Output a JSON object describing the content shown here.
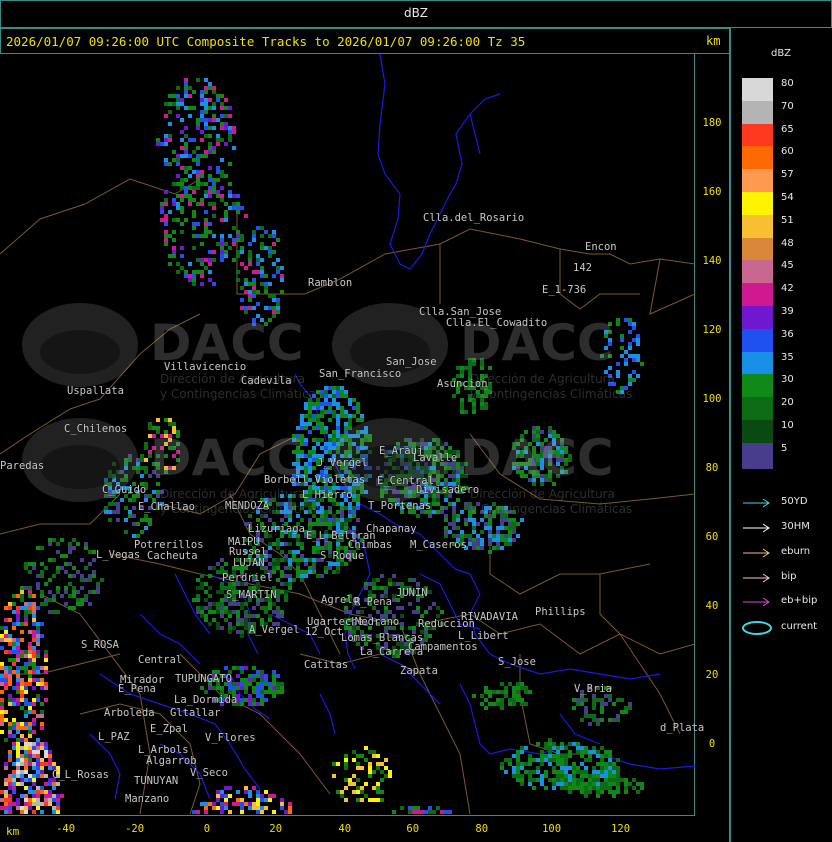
{
  "window": {
    "title": "dBZ"
  },
  "header": {
    "text": "2026/01/07 09:26:00 UTC Composite Tracks to 2026/01/07 09:26:00 Tz 35",
    "unit": "km"
  },
  "axes": {
    "x_unit": "km",
    "x_ticks": [
      "-40",
      "-20",
      "0",
      "20",
      "40",
      "60",
      "80",
      "100",
      "120"
    ],
    "y_ticks": [
      "180",
      "160",
      "140",
      "120",
      "100",
      "80",
      "60",
      "40",
      "20",
      "0"
    ]
  },
  "legend": {
    "title": "dBZ",
    "scale": [
      {
        "label": "80",
        "color": "#d8d8d8"
      },
      {
        "label": "70",
        "color": "#b4b4b4"
      },
      {
        "label": "65",
        "color": "#ff3820"
      },
      {
        "label": "60",
        "color": "#ff6a00"
      },
      {
        "label": "57",
        "color": "#ff9a50"
      },
      {
        "label": "54",
        "color": "#fff400"
      },
      {
        "label": "51",
        "color": "#f8c030"
      },
      {
        "label": "48",
        "color": "#d88838"
      },
      {
        "label": "45",
        "color": "#c86890"
      },
      {
        "label": "42",
        "color": "#d01890"
      },
      {
        "label": "39",
        "color": "#7018d0"
      },
      {
        "label": "36",
        "color": "#2050f0"
      },
      {
        "label": "35",
        "color": "#1890e8"
      },
      {
        "label": "30",
        "color": "#108818"
      },
      {
        "label": "20",
        "color": "#0c6c14"
      },
      {
        "label": "10",
        "color": "#084a10"
      },
      {
        "label": "5",
        "color": "#483c8c"
      }
    ],
    "tracks": [
      {
        "label": "50YD",
        "color": "#40d8e0"
      },
      {
        "label": "30HM",
        "color": "#ffffff"
      },
      {
        "label": "eburn",
        "color": "#f0c080"
      },
      {
        "label": "bip",
        "color": "#f8c8c8"
      },
      {
        "label": "eb+bip",
        "color": "#e040e0"
      },
      {
        "label": "current",
        "color": "#40d8e0"
      }
    ]
  },
  "watermark": {
    "name": "DACC",
    "line1": "Dirección de Agricultura",
    "line2": "y Contingencias Climáticas"
  },
  "places": [
    {
      "name": "Clla.del_Rosario"
    },
    {
      "name": "Encon"
    },
    {
      "name": "142"
    },
    {
      "name": "E_1-736"
    },
    {
      "name": "Ramblon"
    },
    {
      "name": "Clla.San_Jose"
    },
    {
      "name": "Clla.El_Cowadito"
    },
    {
      "name": "Villavicencio"
    },
    {
      "name": "San_Francisco"
    },
    {
      "name": "San_Jose"
    },
    {
      "name": "Asuncion"
    },
    {
      "name": "Uspallata"
    },
    {
      "name": "Cadevila"
    },
    {
      "name": "C_Chilenos"
    },
    {
      "name": "E_Arauj"
    },
    {
      "name": "Lavalle"
    },
    {
      "name": "Paredas"
    },
    {
      "name": "J_Vergel"
    },
    {
      "name": "Borbell_Violetas"
    },
    {
      "name": "E_Central"
    },
    {
      "name": "Divisadero"
    },
    {
      "name": "C_Guido"
    },
    {
      "name": "E_Challao"
    },
    {
      "name": "L_Hierro"
    },
    {
      "name": "MENDOZA"
    },
    {
      "name": "T_Portenas"
    },
    {
      "name": "Lizuriaga"
    },
    {
      "name": "E_L_Beltran"
    },
    {
      "name": "Chapanay"
    },
    {
      "name": "Potrerillos"
    },
    {
      "name": "M_Caseros"
    },
    {
      "name": "L_Vegas"
    },
    {
      "name": "Cacheuta"
    },
    {
      "name": "Chimbas"
    },
    {
      "name": "S_Roque"
    },
    {
      "name": "MAIPU"
    },
    {
      "name": "Russel"
    },
    {
      "name": "LUJAN"
    },
    {
      "name": "Perdriel"
    },
    {
      "name": "S_MARTIN"
    },
    {
      "name": "Agrelo"
    },
    {
      "name": "R_Pena"
    },
    {
      "name": "JUNIN"
    },
    {
      "name": "A_Vergel"
    },
    {
      "name": "Ugarteche"
    },
    {
      "name": "Medrano"
    },
    {
      "name": "RIVADAVIA"
    },
    {
      "name": "12_Oct"
    },
    {
      "name": "Reduccion"
    },
    {
      "name": "Phillips"
    },
    {
      "name": "Lomas_Blancas"
    },
    {
      "name": "L_Libert"
    },
    {
      "name": "S_ROSA"
    },
    {
      "name": "La_Carrera"
    },
    {
      "name": "Campamentos"
    },
    {
      "name": "Central"
    },
    {
      "name": "S_Jose"
    },
    {
      "name": "Catitas"
    },
    {
      "name": "Zapata"
    },
    {
      "name": "Mirador"
    },
    {
      "name": "E_Pena"
    },
    {
      "name": "TUPUNGATO"
    },
    {
      "name": "V_Bria"
    },
    {
      "name": "La_Dormida"
    },
    {
      "name": "Arboleda"
    },
    {
      "name": "Gltallar"
    },
    {
      "name": "E_Zpal"
    },
    {
      "name": "d_Plata"
    },
    {
      "name": "L_PAZ"
    },
    {
      "name": "L_Arbols"
    },
    {
      "name": "Algarrob"
    },
    {
      "name": "V_Seco"
    },
    {
      "name": "TUNUYAN"
    },
    {
      "name": "C_L_Rosas"
    },
    {
      "name": "Manzano"
    },
    {
      "name": "V_Flores"
    },
    {
      "name": "Zapata"
    }
  ]
}
